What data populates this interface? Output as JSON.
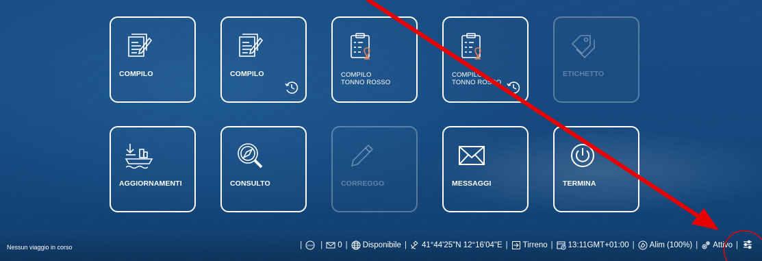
{
  "status_text": "Nessun viaggio in corso",
  "tiles": [
    {
      "label": "COMPILO",
      "icon": "edit-document-icon",
      "enabled": true
    },
    {
      "label": "COMPILO",
      "icon": "edit-document-icon",
      "badge": "history-clock-icon",
      "enabled": true
    },
    {
      "label_line1": "COMPILO",
      "label_line2": "TONNO ROSSO",
      "icon": "clipboard-fish-icon",
      "enabled": true
    },
    {
      "label_line1": "COMPILO",
      "label_line2": "TONNO ROSSO",
      "icon": "clipboard-fish-icon",
      "badge": "history-clock-icon",
      "enabled": true
    },
    {
      "label": "ETICHETTO",
      "icon": "tags-icon",
      "enabled": false
    },
    {
      "label": "AGGIORNAMENTI",
      "icon": "ship-download-icon",
      "enabled": true
    },
    {
      "label": "CONSULTO",
      "icon": "compass-search-icon",
      "enabled": true
    },
    {
      "label": "CORREGGO",
      "icon": "pencil-icon",
      "enabled": false
    },
    {
      "label": "MESSAGGI",
      "icon": "envelope-icon",
      "enabled": true
    },
    {
      "label": "TERMINA",
      "icon": "power-icon",
      "enabled": true
    }
  ],
  "statusbar": {
    "stop_icon": "stop-icon",
    "messages_count": "0",
    "network": "Disponibile",
    "gps": "41°44'25\"N 12°16'04\"E",
    "zone": "Tirreno",
    "time": "13:11GMT+01:00",
    "power": "Alim (100%)",
    "service": "Attivo"
  },
  "annotation": {
    "arrow_color": "#e60000",
    "circle_color": "#e60000"
  }
}
